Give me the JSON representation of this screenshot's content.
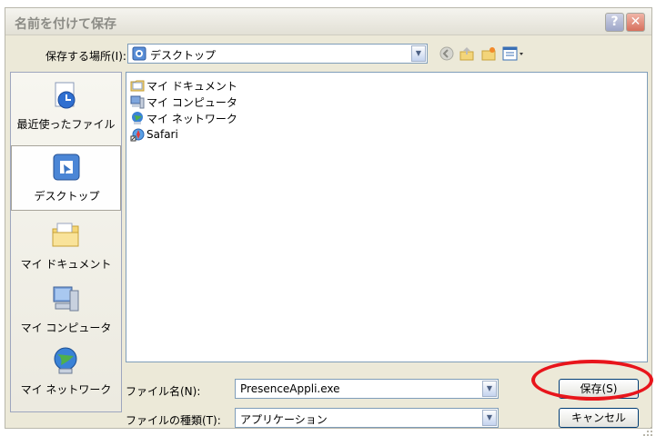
{
  "window": {
    "title": "名前を付けて保存",
    "help_btn": "?",
    "close_btn": "✕"
  },
  "location": {
    "label": "保存する場所(I):",
    "value": "デスクトップ"
  },
  "places": [
    {
      "label": "最近使ったファイル",
      "icon": "recent-icon"
    },
    {
      "label": "デスクトップ",
      "icon": "desktop-icon"
    },
    {
      "label": "マイ ドキュメント",
      "icon": "my-documents-icon"
    },
    {
      "label": "マイ コンピュータ",
      "icon": "my-computer-icon"
    },
    {
      "label": "マイ ネットワーク",
      "icon": "my-network-icon"
    }
  ],
  "files": [
    {
      "name": "マイ ドキュメント",
      "icon": "folder-icon"
    },
    {
      "name": "マイ コンピュータ",
      "icon": "computer-icon"
    },
    {
      "name": "マイ ネットワーク",
      "icon": "network-icon"
    },
    {
      "name": "Safari",
      "icon": "safari-shortcut-icon"
    }
  ],
  "filename": {
    "label": "ファイル名(N):",
    "value": "PresenceAppli.exe"
  },
  "filetype": {
    "label": "ファイルの種類(T):",
    "value": "アプリケーション"
  },
  "buttons": {
    "save": "保存(S)",
    "cancel": "キャンセル"
  },
  "colors": {
    "highlight": "#e8151b",
    "border": "#7f9db9"
  }
}
